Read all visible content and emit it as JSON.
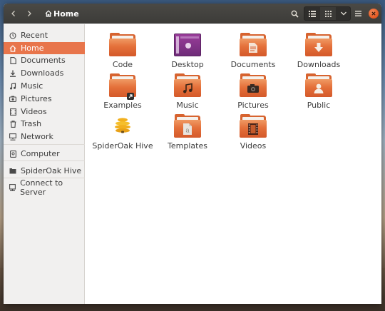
{
  "window": {
    "location": "Home"
  },
  "sidebar": {
    "items": [
      {
        "label": "Recent",
        "icon": "clock-icon"
      },
      {
        "label": "Home",
        "icon": "home-icon",
        "active": true
      },
      {
        "label": "Documents",
        "icon": "document-icon"
      },
      {
        "label": "Downloads",
        "icon": "download-icon"
      },
      {
        "label": "Music",
        "icon": "music-icon"
      },
      {
        "label": "Pictures",
        "icon": "camera-icon"
      },
      {
        "label": "Videos",
        "icon": "film-icon"
      },
      {
        "label": "Trash",
        "icon": "trash-icon"
      },
      {
        "label": "Network",
        "icon": "network-icon"
      },
      {
        "label": "Computer",
        "icon": "computer-icon"
      },
      {
        "label": "SpiderOak Hive",
        "icon": "drive-icon"
      },
      {
        "label": "Connect to Server",
        "icon": "server-icon"
      }
    ]
  },
  "files": [
    {
      "label": "Code",
      "icon": "folder-icon"
    },
    {
      "label": "Desktop",
      "icon": "desktop-folder-icon"
    },
    {
      "label": "Documents",
      "icon": "documents-folder-icon"
    },
    {
      "label": "Downloads",
      "icon": "downloads-folder-icon"
    },
    {
      "label": "Examples",
      "icon": "examples-folder-icon"
    },
    {
      "label": "Music",
      "icon": "music-folder-icon"
    },
    {
      "label": "Pictures",
      "icon": "pictures-folder-icon"
    },
    {
      "label": "Public",
      "icon": "public-folder-icon"
    },
    {
      "label": "SpiderOak Hive",
      "icon": "spideroak-hive-icon"
    },
    {
      "label": "Templates",
      "icon": "templates-folder-icon"
    },
    {
      "label": "Videos",
      "icon": "videos-folder-icon"
    }
  ],
  "colors": {
    "accent": "#e8754b",
    "folder": "#e4703a",
    "close": "#e5561f",
    "headerbar": "#3d3c39"
  }
}
